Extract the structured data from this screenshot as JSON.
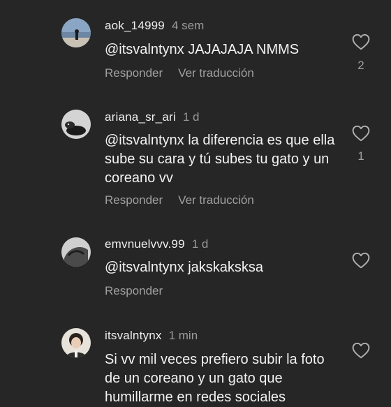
{
  "comments": [
    {
      "username": "aok_14999",
      "time": "4 sem",
      "text": "@itsvalntynx JAJAJAJA NMMS",
      "reply": "Responder",
      "translate": "Ver traducción",
      "likes": "2"
    },
    {
      "username": "ariana_sr_ari",
      "time": "1 d",
      "text": "@itsvalntynx la diferencia es que ella sube su cara y tú subes tu gato y un coreano vv",
      "reply": "Responder",
      "translate": "Ver traducción",
      "likes": "1"
    },
    {
      "username": "emvnuelvvv.99",
      "time": "1 d",
      "text": "@itsvalntynx jakskaksksa",
      "reply": "Responder"
    },
    {
      "username": "itsvalntynx",
      "time": "1 min",
      "text": "Si vv mil veces prefiero subir la foto de un coreano y un gato que humillarme en redes sociales"
    }
  ],
  "icons": {
    "like": "heart-outline-icon"
  },
  "colors": {
    "background": "#262626",
    "muted": "#a0a0a0"
  }
}
